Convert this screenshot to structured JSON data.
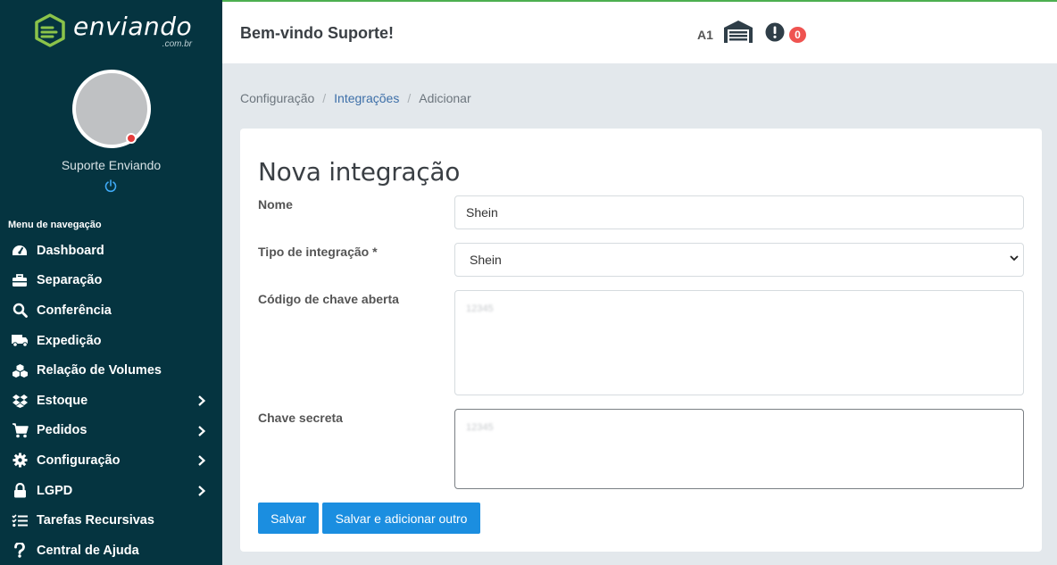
{
  "app": {
    "logo_text": "enviando",
    "logo_sub": ".com.br",
    "brand_color": "#4caf50"
  },
  "sidebar": {
    "user_name": "Suporte Enviando",
    "menu_title": "Menu de navegação",
    "items": [
      {
        "label": "Dashboard",
        "icon": "gauge-icon",
        "has_submenu": false
      },
      {
        "label": "Separação",
        "icon": "toolbox-icon",
        "has_submenu": false
      },
      {
        "label": "Conferência",
        "icon": "search-icon",
        "has_submenu": false
      },
      {
        "label": "Expedição",
        "icon": "truck-icon",
        "has_submenu": false
      },
      {
        "label": "Relação de Volumes",
        "icon": "cubes-icon",
        "has_submenu": false
      },
      {
        "label": "Estoque",
        "icon": "dropbox-icon",
        "has_submenu": true
      },
      {
        "label": "Pedidos",
        "icon": "cart-icon",
        "has_submenu": true
      },
      {
        "label": "Configuração",
        "icon": "gear-icon",
        "has_submenu": true
      },
      {
        "label": "LGPD",
        "icon": "lock-icon",
        "has_submenu": true
      },
      {
        "label": "Tarefas Recursivas",
        "icon": "tasks-icon",
        "has_submenu": false
      },
      {
        "label": "Central de Ajuda",
        "icon": "question-icon",
        "has_submenu": false
      }
    ]
  },
  "header": {
    "welcome": "Bem-vindo Suporte!",
    "warehouse_code": "A1",
    "alert_count": "0"
  },
  "breadcrumb": {
    "items": [
      "Configuração",
      "Integrações",
      "Adicionar"
    ]
  },
  "form": {
    "title": "Nova integração",
    "nome_label": "Nome",
    "nome_value": "Shein",
    "tipo_label": "Tipo de integração *",
    "tipo_value": "Shein",
    "codigo_label": "Código de chave aberta",
    "codigo_value": "12345",
    "chave_label": "Chave secreta",
    "chave_value": "12345",
    "save_button": "Salvar",
    "save_add_button": "Salvar e adicionar outro"
  }
}
